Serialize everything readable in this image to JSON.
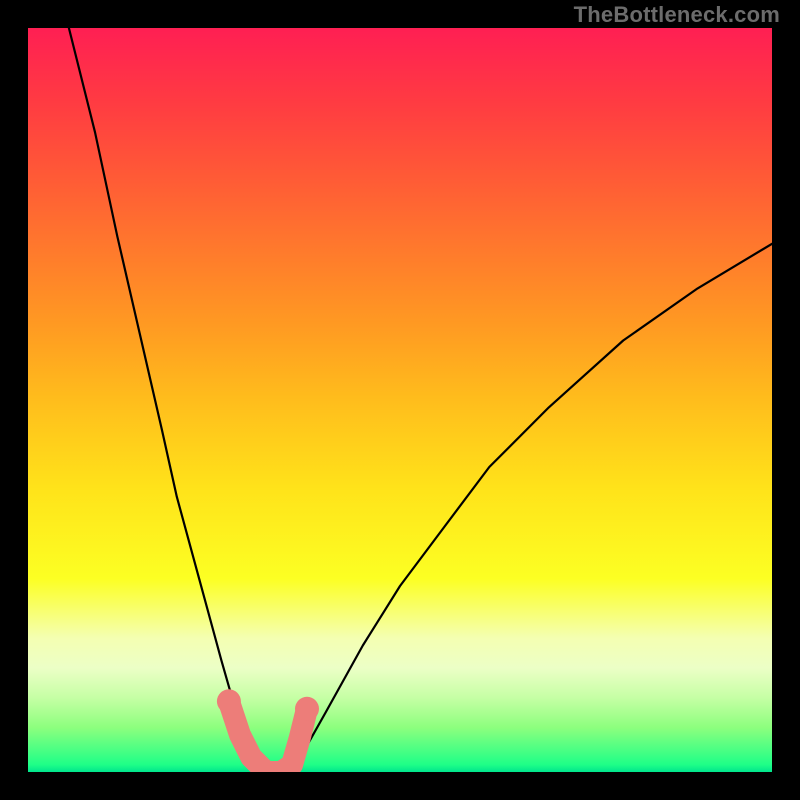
{
  "watermark": "TheBottleneck.com",
  "colors": {
    "frame": "#000000",
    "overlay_stroke": "#ed7d79",
    "curve_stroke": "#000000"
  },
  "chart_data": {
    "type": "line",
    "title": "",
    "xlabel": "",
    "ylabel": "",
    "xlim": [
      0,
      1
    ],
    "ylim": [
      0,
      1
    ],
    "note": "No axis ticks or labels are visible in the image. Values are normalized 0–1 estimates read from the plotted curves.",
    "series": [
      {
        "name": "left-curve",
        "x": [
          0.055,
          0.09,
          0.12,
          0.15,
          0.18,
          0.2,
          0.23,
          0.26,
          0.28,
          0.3,
          0.32
        ],
        "values": [
          1.0,
          0.86,
          0.72,
          0.59,
          0.46,
          0.37,
          0.26,
          0.15,
          0.08,
          0.03,
          0.0
        ]
      },
      {
        "name": "right-curve",
        "x": [
          0.355,
          0.4,
          0.45,
          0.5,
          0.56,
          0.62,
          0.7,
          0.8,
          0.9,
          1.0
        ],
        "values": [
          0.0,
          0.08,
          0.17,
          0.25,
          0.33,
          0.41,
          0.49,
          0.58,
          0.65,
          0.71
        ]
      },
      {
        "name": "pink-overlay",
        "x": [
          0.27,
          0.285,
          0.3,
          0.32,
          0.34,
          0.355,
          0.365,
          0.375
        ],
        "values": [
          0.095,
          0.05,
          0.02,
          0.0,
          0.0,
          0.01,
          0.045,
          0.085
        ]
      }
    ],
    "points": [
      {
        "name": "pink-start-dot",
        "x": 0.27,
        "y": 0.095
      },
      {
        "name": "pink-end-dot",
        "x": 0.375,
        "y": 0.085
      }
    ]
  }
}
